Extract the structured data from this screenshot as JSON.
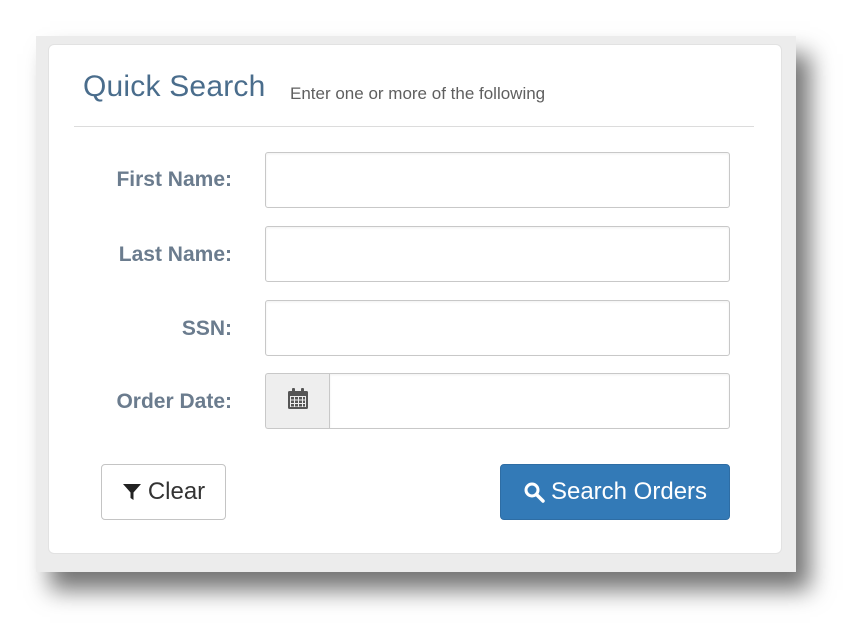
{
  "panel": {
    "title": "Quick Search",
    "subtitle": "Enter one or more of the following"
  },
  "fields": {
    "first_name": {
      "label": "First Name:",
      "value": "",
      "placeholder": ""
    },
    "last_name": {
      "label": "Last Name:",
      "value": "",
      "placeholder": ""
    },
    "ssn": {
      "label": "SSN:",
      "value": "",
      "placeholder": ""
    },
    "order_date": {
      "label": "Order Date:",
      "value": "",
      "placeholder": "",
      "icon": "calendar-icon"
    }
  },
  "buttons": {
    "clear": {
      "label": "Clear",
      "icon": "filter-icon"
    },
    "search": {
      "label": "Search Orders",
      "icon": "search-icon"
    }
  },
  "colors": {
    "title": "#4a6d8c",
    "label": "#6b7c8e",
    "primary_button": "#337ab7"
  }
}
